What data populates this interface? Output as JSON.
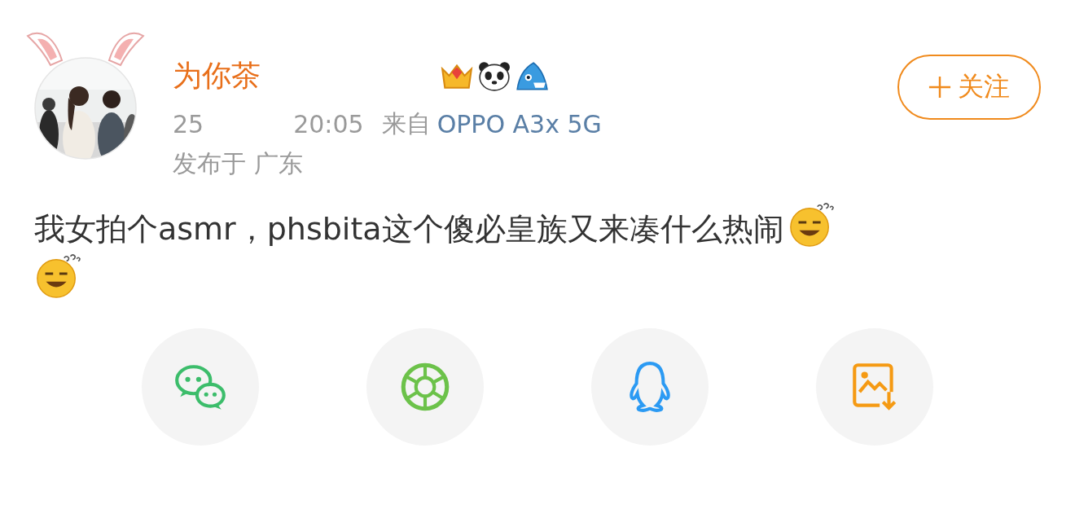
{
  "post": {
    "author": {
      "name": "为你茶",
      "following": false
    },
    "time_start": "25",
    "time_end": "20:05",
    "source_prefix": "来自",
    "source": "OPPO A3x 5G",
    "location": "发布于 广东",
    "text": "我女拍个asmr，phsbita这个傻必皇族又来凑什么热闹"
  },
  "follow_button": {
    "label": "关注"
  },
  "share_buttons": [
    {
      "kind": "wechat"
    },
    {
      "kind": "moments"
    },
    {
      "kind": "qq"
    },
    {
      "kind": "save-image"
    }
  ]
}
